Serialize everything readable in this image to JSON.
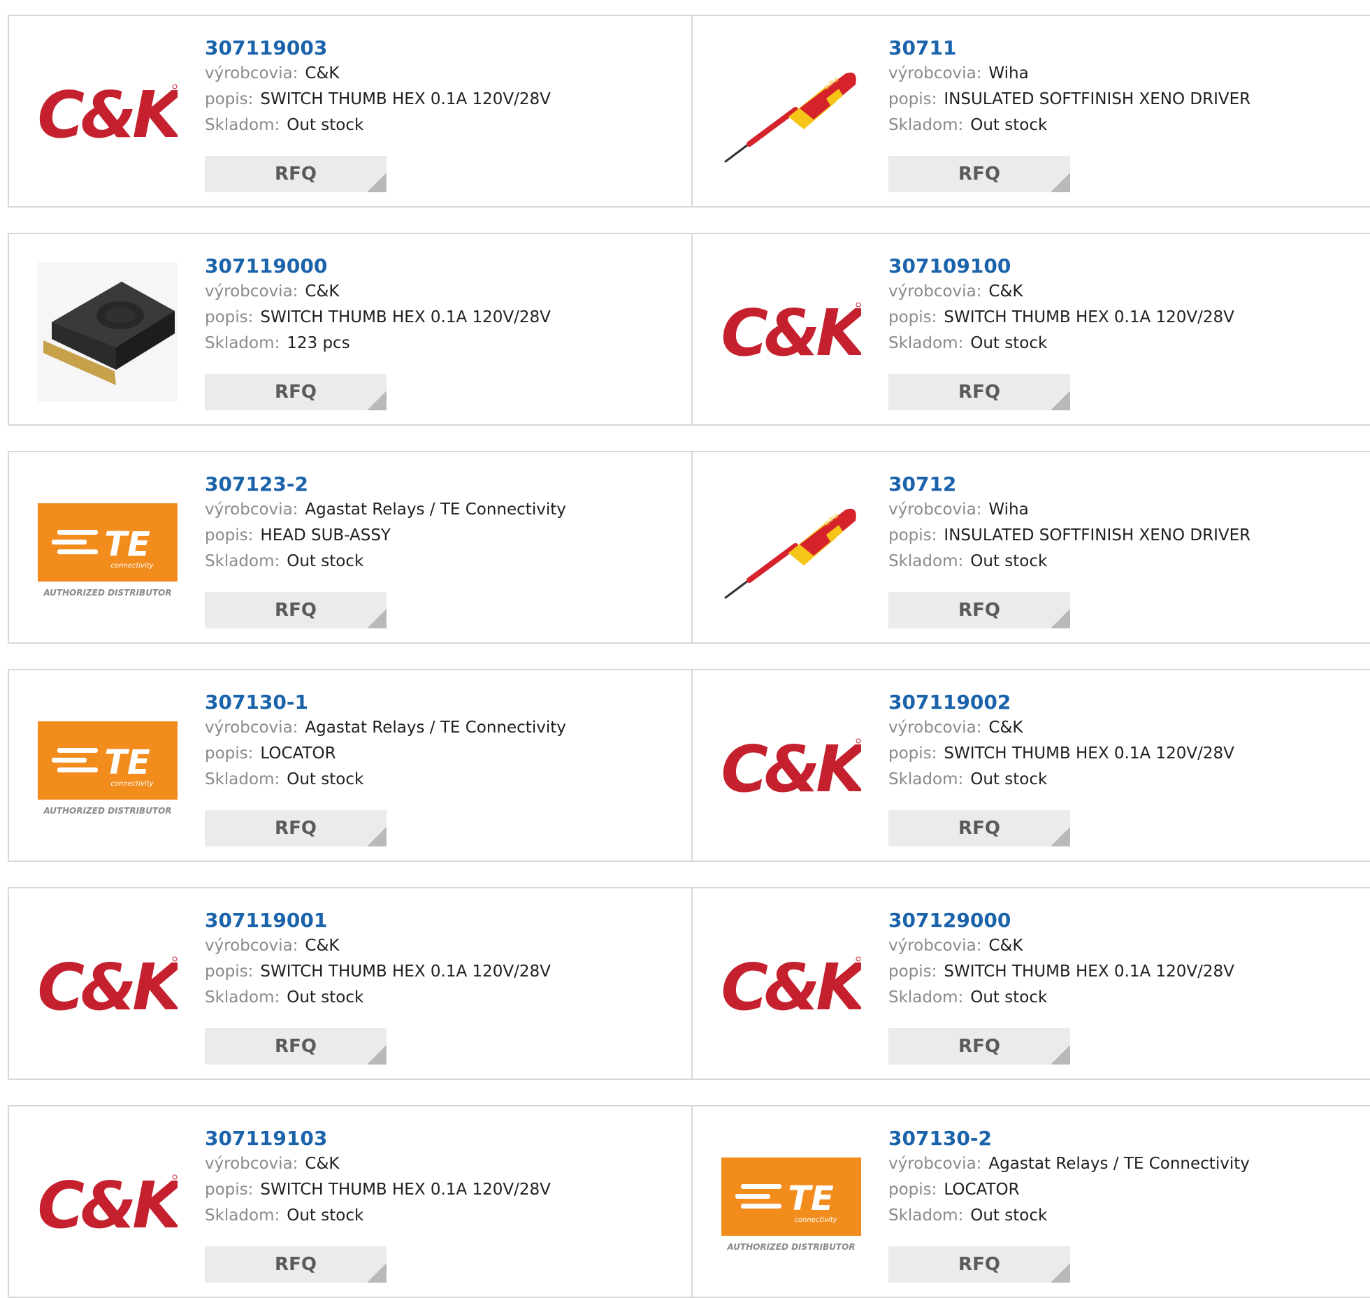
{
  "labels": {
    "manufacturer": "výrobcovia:",
    "description": "popis:",
    "stock": "Skladom:",
    "rfq": "RFQ"
  },
  "logos": {
    "ck": "C&K",
    "te": "TE",
    "te_sub": "connectivity",
    "te_distributor": "AUTHORIZED DISTRIBUTOR",
    "wiha": "wiha"
  },
  "colors": {
    "link": "#1a63aa",
    "ck_red": "#c5202e",
    "te_orange": "#f28c1d",
    "rfq_bg": "#ebebeb",
    "border": "#d8d8d8"
  },
  "products": [
    {
      "part": "307119003",
      "image": "ck-logo",
      "manufacturer": "C&K",
      "description": "SWITCH THUMB HEX 0.1A 120V/28V",
      "stock": "Out stock"
    },
    {
      "part": "30711",
      "image": "wiha-screwdriver",
      "manufacturer": "Wiha",
      "description": "INSULATED SOFTFINISH XENO DRIVER",
      "stock": "Out stock"
    },
    {
      "part": "307119000",
      "image": "thumbwheel-switch",
      "manufacturer": "C&K",
      "description": "SWITCH THUMB HEX 0.1A 120V/28V",
      "stock": "123 pcs"
    },
    {
      "part": "307109100",
      "image": "ck-logo",
      "manufacturer": "C&K",
      "description": "SWITCH THUMB HEX 0.1A 120V/28V",
      "stock": "Out stock"
    },
    {
      "part": "307123-2",
      "image": "te-logo",
      "manufacturer": "Agastat Relays / TE Connectivity",
      "description": "HEAD SUB-ASSY",
      "stock": "Out stock"
    },
    {
      "part": "30712",
      "image": "wiha-screwdriver",
      "manufacturer": "Wiha",
      "description": "INSULATED SOFTFINISH XENO DRIVER",
      "stock": "Out stock"
    },
    {
      "part": "307130-1",
      "image": "te-logo",
      "manufacturer": "Agastat Relays / TE Connectivity",
      "description": "LOCATOR",
      "stock": "Out stock"
    },
    {
      "part": "307119002",
      "image": "ck-logo",
      "manufacturer": "C&K",
      "description": "SWITCH THUMB HEX 0.1A 120V/28V",
      "stock": "Out stock"
    },
    {
      "part": "307119001",
      "image": "ck-logo",
      "manufacturer": "C&K",
      "description": "SWITCH THUMB HEX 0.1A 120V/28V",
      "stock": "Out stock"
    },
    {
      "part": "307129000",
      "image": "ck-logo",
      "manufacturer": "C&K",
      "description": "SWITCH THUMB HEX 0.1A 120V/28V",
      "stock": "Out stock"
    },
    {
      "part": "307119103",
      "image": "ck-logo",
      "manufacturer": "C&K",
      "description": "SWITCH THUMB HEX 0.1A 120V/28V",
      "stock": "Out stock"
    },
    {
      "part": "307130-2",
      "image": "te-logo",
      "manufacturer": "Agastat Relays / TE Connectivity",
      "description": "LOCATOR",
      "stock": "Out stock"
    }
  ]
}
